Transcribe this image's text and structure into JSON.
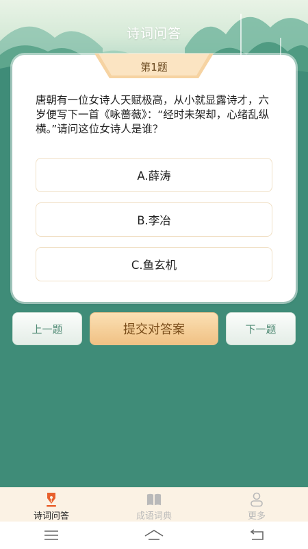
{
  "header": {
    "title": "诗词问答"
  },
  "question": {
    "number_label": "第1题",
    "text": "唐朝有一位女诗人天赋极高，从小就显露诗才，六岁便写下一首《咏蔷薇》：“经时未架却，心绪乱纵横。”请问这位女诗人是谁？",
    "options": [
      {
        "label": "A.薛涛"
      },
      {
        "label": "B.李冶"
      },
      {
        "label": "C.鱼玄机"
      }
    ]
  },
  "actions": {
    "prev_label": "上一题",
    "submit_label": "提交对答案",
    "next_label": "下一题"
  },
  "tabbar": {
    "items": [
      {
        "label": "诗词问答",
        "active": true,
        "icon": "pen-nib-icon"
      },
      {
        "label": "成语词典",
        "active": false,
        "icon": "book-icon"
      },
      {
        "label": "更多",
        "active": false,
        "icon": "person-icon"
      }
    ]
  },
  "colors": {
    "background": "#3f8c78",
    "accent": "#f0c184",
    "active_tab": "#e8602c",
    "inactive_tab": "#b9b9b9"
  }
}
